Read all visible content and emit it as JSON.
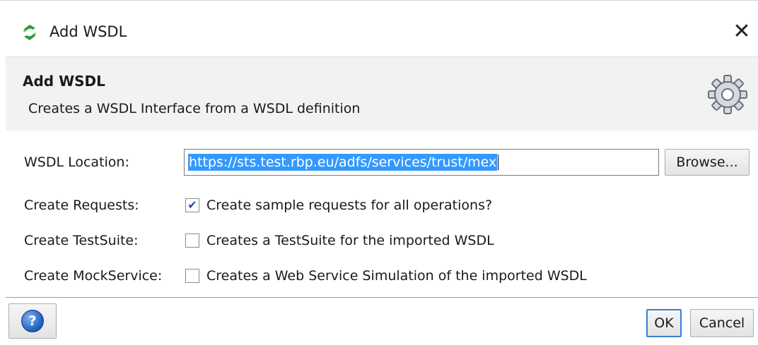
{
  "window": {
    "title": "Add WSDL",
    "close_glyph": "✕"
  },
  "banner": {
    "title": "Add WSDL",
    "description": "Creates a WSDL Interface from a WSDL definition",
    "icon": "gear-icon"
  },
  "form": {
    "wsdl_location": {
      "label": "WSDL Location:",
      "value": "https://sts.test.rbp.eu/adfs/services/trust/mex",
      "browse_label": "Browse..."
    },
    "create_requests": {
      "label": "Create Requests:",
      "checked": true,
      "text": "Create sample requests for all operations?"
    },
    "create_testsuite": {
      "label": "Create TestSuite:",
      "checked": false,
      "text": "Creates a TestSuite for the imported WSDL"
    },
    "create_mockservice": {
      "label": "Create MockService:",
      "checked": false,
      "text": "Creates a Web Service Simulation of the imported WSDL"
    }
  },
  "footer": {
    "help_glyph": "?",
    "ok_label": "OK",
    "cancel_label": "Cancel"
  },
  "colors": {
    "selection": "#3399ff",
    "banner_bg": "#f2f2f2",
    "focus_border": "#3c7fd8"
  }
}
